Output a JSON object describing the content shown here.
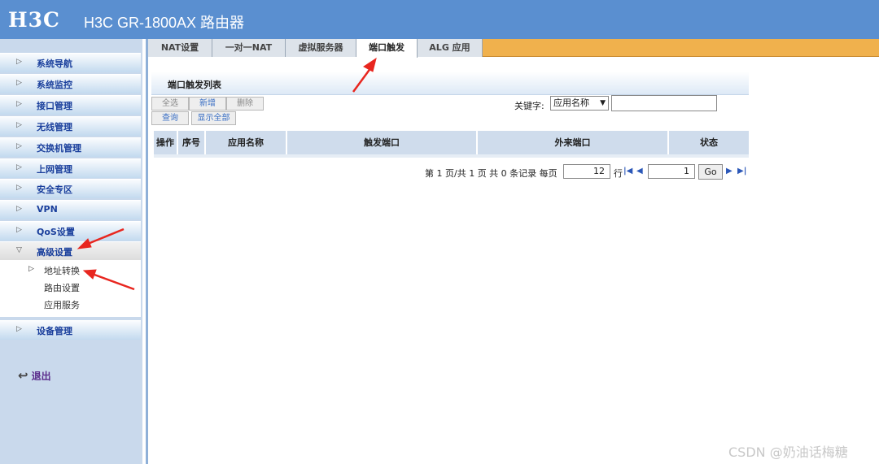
{
  "header": {
    "logo": "H3C",
    "product": "H3C GR-1800AX 路由器"
  },
  "sidebar": {
    "items": [
      {
        "label": "系统导航"
      },
      {
        "label": "系统监控"
      },
      {
        "label": "接口管理"
      },
      {
        "label": "无线管理"
      },
      {
        "label": "交换机管理"
      },
      {
        "label": "上网管理"
      },
      {
        "label": "安全专区"
      },
      {
        "label": "VPN"
      },
      {
        "label": "QoS设置"
      },
      {
        "label": "高级设置"
      },
      {
        "label": "设备管理"
      }
    ],
    "sub_items": [
      {
        "label": "地址转换"
      },
      {
        "label": "路由设置"
      },
      {
        "label": "应用服务"
      }
    ],
    "logout": "退出"
  },
  "tabs": [
    {
      "label": "NAT设置"
    },
    {
      "label": "一对一NAT"
    },
    {
      "label": "虚拟服务器"
    },
    {
      "label": "端口触发"
    },
    {
      "label": "ALG 应用"
    }
  ],
  "active_tab": "端口触发",
  "list": {
    "title": "端口触发列表",
    "buttons": {
      "select_all": "全选",
      "add": "新增",
      "delete": "删除",
      "query": "查询",
      "show_all": "显示全部"
    },
    "keyword_label": "关键字:",
    "keyword_select": "应用名称",
    "keyword_value": ""
  },
  "table": {
    "columns": [
      "操作",
      "序号",
      "应用名称",
      "触发端口",
      "外来端口",
      "状态"
    ],
    "rows": []
  },
  "pager": {
    "summary": "第 1 页/共 1 页 共 0 条记录 每页",
    "per_page": "12",
    "per_page_unit": "行",
    "page": "1",
    "go": "Go"
  },
  "watermark": "CSDN @奶油话梅糖",
  "colors": {
    "header": "#5a8fd0",
    "tabbar": "#f0b14d",
    "nav_text": "#1a3f9c",
    "annotation_arrow": "#e8261f"
  }
}
